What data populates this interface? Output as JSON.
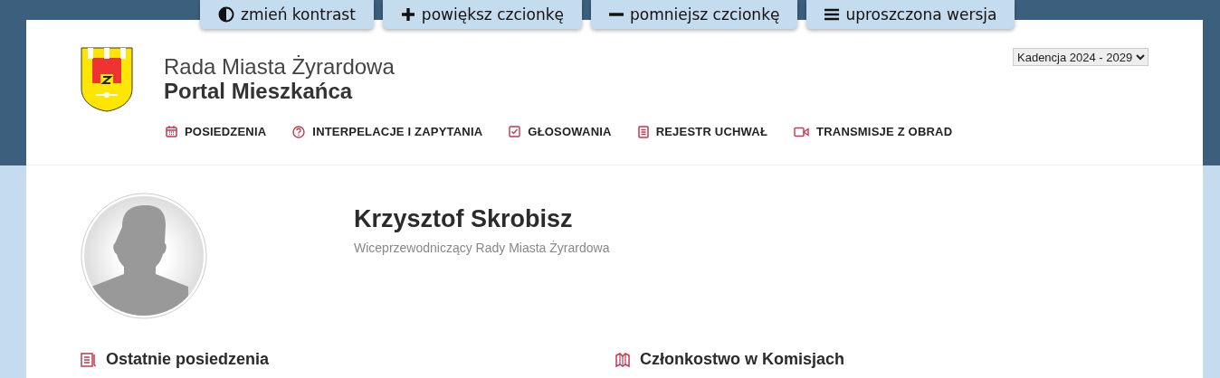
{
  "accessibility_bar": [
    "zmień kontrast",
    "powiększ czcionkę",
    "pomniejsz czcionkę",
    "uproszczona wersja"
  ],
  "header": {
    "title": "Rada Miasta Żyrardowa",
    "subtitle": "Portal Mieszkańca",
    "term_select": {
      "value": "Kadencja 2024 - 2029"
    }
  },
  "nav": [
    "POSIEDZENIA",
    "INTERPELACJE I ZAPYTANIA",
    "GŁOSOWANIA",
    "REJESTR UCHWAŁ",
    "TRANSMISJE Z OBRAD"
  ],
  "profile": {
    "name": "Krzysztof Skrobisz",
    "role": "Wiceprzewodniczący Rady Miasta Żyrardowa"
  },
  "sections": [
    "Ostatnie posiedzenia",
    "Członkostwo w Komisjach"
  ]
}
